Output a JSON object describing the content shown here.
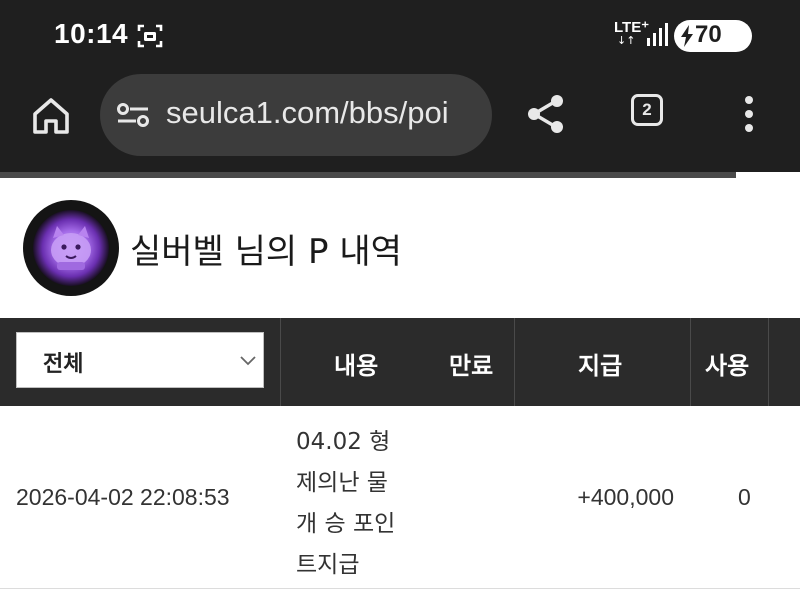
{
  "status_bar": {
    "time": "10:14",
    "network": "LTE⁺",
    "network_arrows": "↓↑",
    "battery": "70"
  },
  "browser": {
    "url": "seulca1.com/bbs/poi",
    "tab_count": "2",
    "load_progress": 0.92
  },
  "page": {
    "title": "실버벨 님의 P 내역"
  },
  "table": {
    "filter": {
      "selected": "전체"
    },
    "headers": {
      "content": "내용",
      "expire": "만료",
      "granted": "지급",
      "used": "사용"
    },
    "rows": [
      {
        "date": "2026-04-02 22:08:53",
        "content_lines": [
          "04.02 형",
          "제의난 물",
          "개 승 포인",
          "트지급"
        ],
        "amount": "+400,000",
        "used": "0"
      }
    ]
  },
  "colors": {
    "bar_bg": "#1f1f1f",
    "url_pill": "#3c3c3c",
    "header_bg": "#2b2b2b",
    "avatar_glow": "#9b5de5"
  }
}
